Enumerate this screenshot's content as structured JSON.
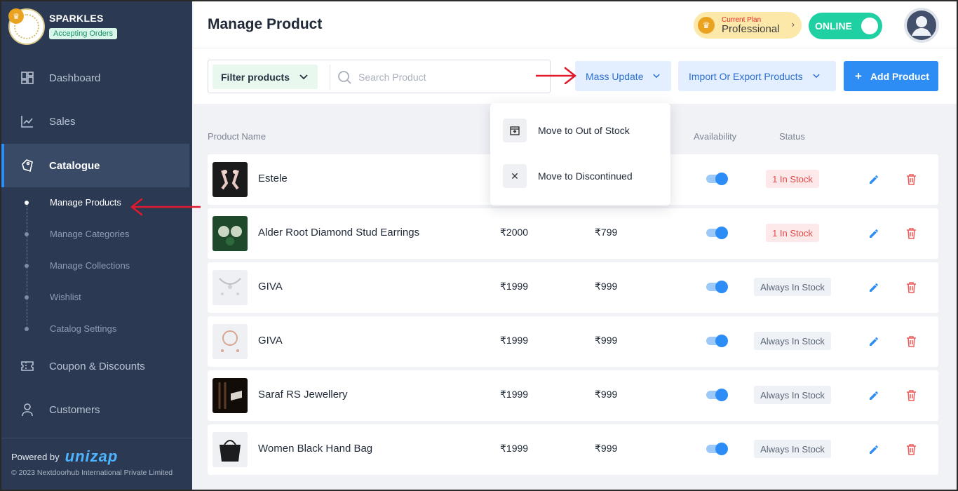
{
  "brand": {
    "store_name": "SPARKLES",
    "order_status": "Accepting Orders"
  },
  "nav": {
    "dashboard": "Dashboard",
    "sales": "Sales",
    "catalogue": "Catalogue",
    "coupons": "Coupon & Discounts",
    "customers": "Customers"
  },
  "subnav": [
    "Manage Products",
    "Manage Categories",
    "Manage Collections",
    "Wishlist",
    "Catalog Settings"
  ],
  "footer": {
    "powered_by": "Powered by",
    "logo_text": "unizap",
    "copyright": "© 2023 Nextdoorhub International Private Limited"
  },
  "header": {
    "title": "Manage Product",
    "plan_caption": "Current Plan",
    "plan_name": "Professional",
    "online_label": "ONLINE"
  },
  "toolbar": {
    "filter_label": "Filter products",
    "search_placeholder": "Search Product",
    "mass_update_label": "Mass Update",
    "import_export_label": "Import Or Export Products",
    "add_label": "Add Product"
  },
  "mass_update_menu": [
    "Move to Out of Stock",
    "Move to Discontinued"
  ],
  "table": {
    "columns": {
      "name": "Product Name",
      "availability": "Availability",
      "status": "Status"
    },
    "rows": [
      {
        "name": "Estele",
        "mrp": "",
        "price": "",
        "status": "1 In Stock",
        "available": true
      },
      {
        "name": "Alder Root Diamond Stud Earrings",
        "mrp": "₹2000",
        "price": "₹799",
        "status": "1 In Stock",
        "available": true
      },
      {
        "name": "GIVA",
        "mrp": "₹1999",
        "price": "₹999",
        "status": "Always In Stock",
        "available": true
      },
      {
        "name": "GIVA",
        "mrp": "₹1999",
        "price": "₹999",
        "status": "Always In Stock",
        "available": true
      },
      {
        "name": "Saraf RS Jewellery",
        "mrp": "₹1999",
        "price": "₹999",
        "status": "Always In Stock",
        "available": true
      },
      {
        "name": "Women Black Hand Bag",
        "mrp": "₹1999",
        "price": "₹999",
        "status": "Always In Stock",
        "available": true
      }
    ]
  },
  "colors": {
    "sidebar": "#2b3a52",
    "accent": "#2d8df7",
    "online": "#1fd1a2",
    "annotation_arrow": "#e0192c"
  }
}
